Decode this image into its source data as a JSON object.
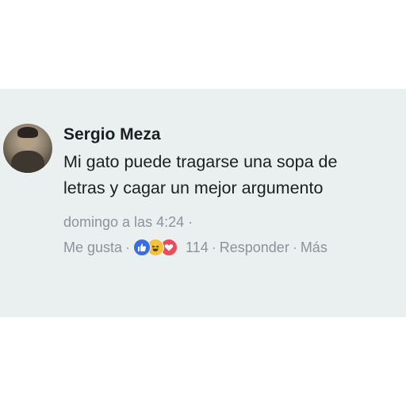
{
  "comment": {
    "author": "Sergio Meza",
    "text_lines": [
      "Mi gato puede tragarse una sopa de",
      "letras y cagar un mejor argumento"
    ],
    "timestamp": "domingo a las 4:24 ·",
    "actions": {
      "like_label": "Me gusta",
      "reaction_count": "114",
      "reply_label": "Responder",
      "more_label": "Más",
      "separator": "·"
    },
    "reactions": [
      "like-icon",
      "haha-icon",
      "love-icon"
    ]
  },
  "colors": {
    "card_background": "#e9f0ef",
    "text": "#1c1e21",
    "meta": "#8c939b",
    "like": "#3b6ce0",
    "haha": "#f5c33b",
    "love": "#ec4b5a"
  }
}
